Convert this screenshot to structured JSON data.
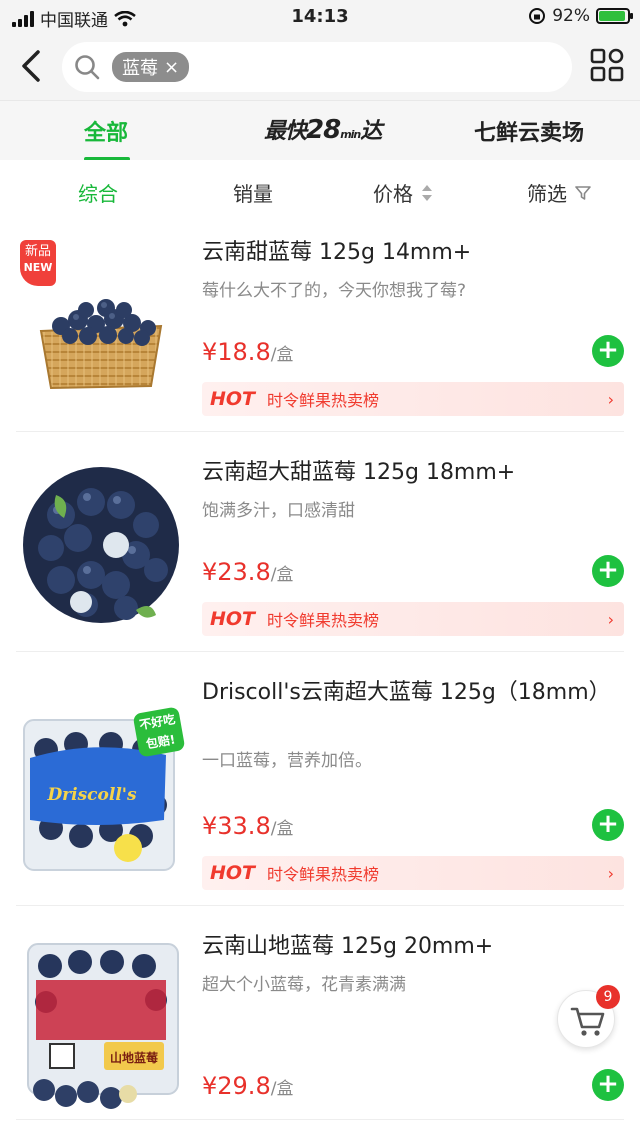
{
  "status_bar": {
    "carrier": "中国联通",
    "time": "14:13",
    "battery": "92%"
  },
  "search": {
    "tag": "蓝莓",
    "tag_close": "×"
  },
  "tabs": [
    {
      "label": "全部"
    },
    {
      "label_main": "最快",
      "label_num": "28",
      "label_min": "min",
      "label_end": "达"
    },
    {
      "label": "七鲜云卖场"
    }
  ],
  "sort": {
    "comprehensive": "综合",
    "sales": "销量",
    "price": "价格",
    "filter": "筛选"
  },
  "colors": {
    "accent": "#18b83a",
    "price": "#e8312b",
    "add": "#1ec140"
  },
  "products": [
    {
      "title": "云南甜蓝莓 125g 14mm+",
      "subtitle": "莓什么大不了的，今天你想我了莓?",
      "price": "¥18.8",
      "unit": "/盒",
      "badge_top": "新品",
      "badge_bottom": "NEW",
      "hot_tag": "HOT",
      "hot_text": "时令鲜果热卖榜",
      "hot_arrow": "›"
    },
    {
      "title": "云南超大甜蓝莓 125g 18mm+",
      "subtitle": "饱满多汁，口感清甜",
      "price": "¥23.8",
      "unit": "/盒",
      "hot_tag": "HOT",
      "hot_text": "时令鲜果热卖榜",
      "hot_arrow": "›"
    },
    {
      "title": "Driscoll's云南超大蓝莓 125g（18mm）",
      "subtitle": "一口蓝莓，营养加倍。",
      "price": "¥33.8",
      "unit": "/盒",
      "sticker": "不好吃包赔!",
      "brand": "Driscoll's",
      "hot_tag": "HOT",
      "hot_text": "时令鲜果热卖榜",
      "hot_arrow": "›"
    },
    {
      "title": "云南山地蓝莓 125g 20mm+",
      "subtitle": "超大个小蓝莓，花青素满满",
      "price": "¥29.8",
      "unit": "/盒",
      "pack_label": "山地蓝莓"
    }
  ],
  "cart": {
    "count": "9"
  }
}
